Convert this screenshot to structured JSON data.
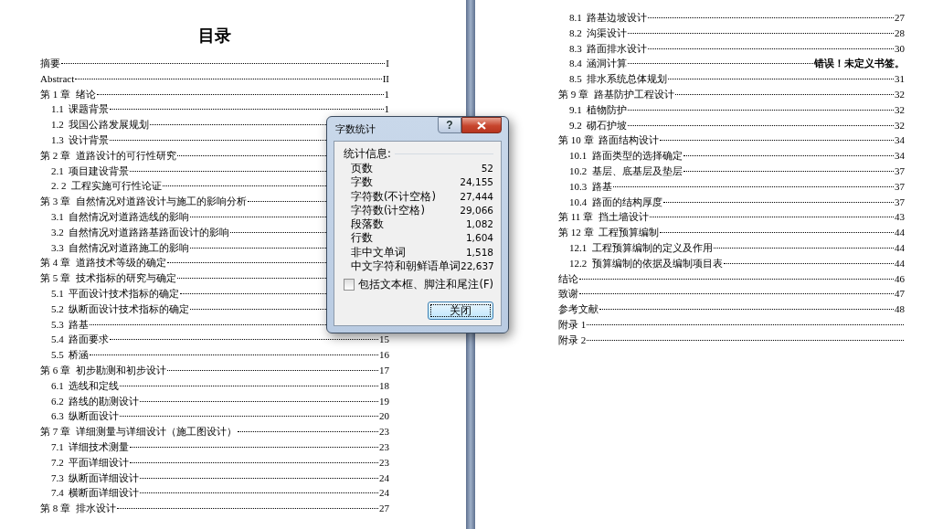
{
  "left_page": {
    "title": "目录",
    "entries": [
      {
        "label": "摘要",
        "page": "I"
      },
      {
        "label": "Abstract",
        "page": "II"
      },
      {
        "label": "第 1 章  绪论",
        "page": "1",
        "children": [
          {
            "label": "1.1  课题背景",
            "page": "1"
          },
          {
            "label": "1.2  我国公路发展规划"
          },
          {
            "label": "1.3  设计背景"
          }
        ]
      },
      {
        "label": "第 2 章  道路设计的可行性研究",
        "children": [
          {
            "label": "2.1  项目建设背景"
          },
          {
            "label": "2. 2  工程实施可行性论证"
          }
        ]
      },
      {
        "label": "第 3 章  自然情况对道路设计与施工的影响分析",
        "children": [
          {
            "label": "3.1  自然情况对道路选线的影响"
          },
          {
            "label": "3.2  自然情况对道路路基路面设计的影响"
          },
          {
            "label": "3.3  自然情况对道路施工的影响"
          }
        ]
      },
      {
        "label": "第 4 章  道路技术等级的确定"
      },
      {
        "label": "第 5 章  技术指标的研究与确定",
        "children": [
          {
            "label": "5.1  平面设计技术指标的确定"
          },
          {
            "label": "5.2  纵断面设计技术指标的确定"
          },
          {
            "label": "5.3  路基"
          },
          {
            "label": "5.4  路面要求",
            "page": "15"
          },
          {
            "label": "5.5  桥涵",
            "page": "16"
          }
        ]
      },
      {
        "label": "第 6 章  初步勘测和初步设计",
        "page": "17",
        "children": [
          {
            "label": "6.1  选线和定线",
            "page": "18"
          },
          {
            "label": "6.2  路线的勘测设计",
            "page": "19"
          },
          {
            "label": "6.3  纵断面设计",
            "page": "20"
          }
        ]
      },
      {
        "label": "第 7 章  详细测量与详细设计（施工图设计）",
        "page": "23",
        "children": [
          {
            "label": "7.1  详细技术测量",
            "page": "23"
          },
          {
            "label": "7.2  平面详细设计",
            "page": "23"
          },
          {
            "label": "7.3  纵断面详细设计",
            "page": "24"
          },
          {
            "label": "7.4  横断面详细设计",
            "page": "24"
          }
        ]
      },
      {
        "label": "第 8 章  排水设计",
        "page": "27"
      }
    ]
  },
  "right_page": {
    "continued_sections": [
      {
        "label": "8.1  路基边坡设计",
        "page": "27"
      },
      {
        "label": "8.2  沟渠设计",
        "page": "28"
      },
      {
        "label": "8.3  路面排水设计",
        "page": "30"
      },
      {
        "label": "8.4  涵洞计算",
        "error": "错误！未定义书签。"
      },
      {
        "label": "8.5  排水系统总体规划",
        "page": "31"
      }
    ],
    "entries": [
      {
        "label": "第 9 章  路基防护工程设计",
        "page": "32",
        "children": [
          {
            "label": "9.1  植物防护",
            "page": "32"
          },
          {
            "label": "9.2  砌石护坡",
            "page": "32"
          }
        ]
      },
      {
        "label": "第 10 章  路面结构设计",
        "page": "34",
        "children": [
          {
            "label": "10.1  路面类型的选择确定",
            "page": "34"
          },
          {
            "label": "10.2  基层、底基层及垫层",
            "page": "37"
          },
          {
            "label": "10.3  路基",
            "page": "37"
          },
          {
            "label": "10.4  路面的结构厚度",
            "page": "37"
          }
        ]
      },
      {
        "label": "第 11 章  挡土墙设计",
        "page": "43"
      },
      {
        "label": "第 12 章  工程预算编制",
        "page": "44",
        "children": [
          {
            "label": "12.1  工程预算编制的定义及作用",
            "page": "44"
          },
          {
            "label": "12.2  预算编制的依据及编制项目表",
            "page": "44"
          }
        ]
      },
      {
        "label": "结论",
        "page": "46"
      },
      {
        "label": "致谢",
        "page": "47"
      },
      {
        "label": "参考文献",
        "page": "48"
      },
      {
        "label": "附录 1"
      },
      {
        "label": "附录 2"
      }
    ]
  },
  "dialog": {
    "title": "字数统计",
    "help_button": "?",
    "group_label": "统计信息:",
    "stats": [
      {
        "label": "页数",
        "value": "52"
      },
      {
        "label": "字数",
        "value": "24,155"
      },
      {
        "label": "字符数(不计空格)",
        "value": "27,444"
      },
      {
        "label": "字符数(计空格)",
        "value": "29,066"
      },
      {
        "label": "段落数",
        "value": "1,082"
      },
      {
        "label": "行数",
        "value": "1,604"
      },
      {
        "label": "非中文单词",
        "value": "1,518"
      },
      {
        "label": "中文字符和朝鲜语单词",
        "value": "22,637"
      }
    ],
    "checkbox": {
      "label": "包括文本框、脚注和尾注(F)",
      "checked": false
    },
    "close_button": "关闭"
  }
}
